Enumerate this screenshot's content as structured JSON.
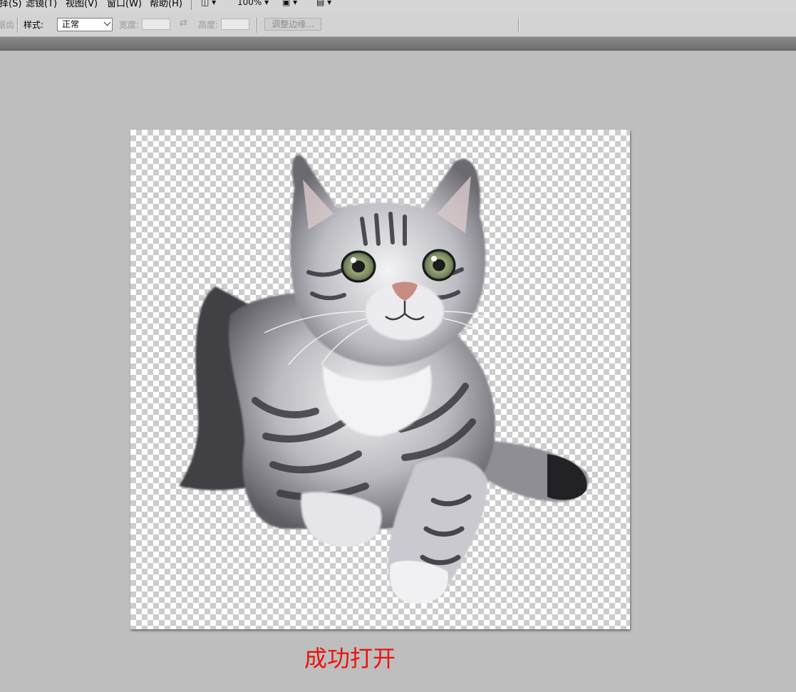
{
  "menubar": {
    "items": [
      "选择(S)",
      "滤镜(T)",
      "视图(V)",
      "窗口(W)",
      "帮助(H)"
    ],
    "zoom": "100%"
  },
  "options": {
    "partial_label": "消除锯齿",
    "style_label": "样式:",
    "style_value": "正常",
    "width_label": "宽度:",
    "height_label": "高度:",
    "refine_edge_label": "调整边缘..."
  },
  "document": {
    "image": "cat-cutout-image",
    "background": "transparency-checkerboard"
  },
  "caption": "成功打开",
  "colors": {
    "caption": "#e8140e",
    "workspace": "#bebebe",
    "toolbar": "#d3d3d3"
  }
}
